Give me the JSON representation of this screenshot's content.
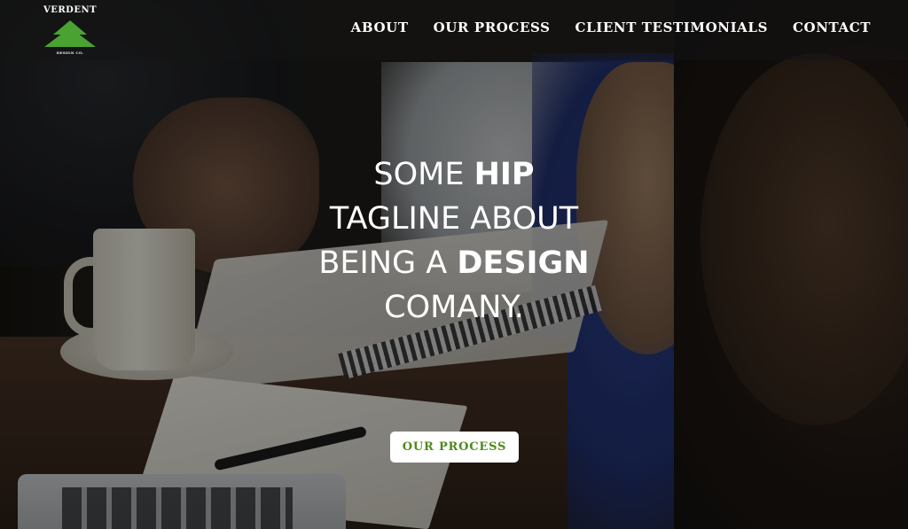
{
  "brand": {
    "name_top": "VERDENT",
    "name_bottom": "DESIGN CO.",
    "logo_icon": "green-pine-tree-icon",
    "accent_color": "#4aa233"
  },
  "nav": {
    "items": [
      {
        "label": "ABOUT"
      },
      {
        "label": "OUR PROCESS"
      },
      {
        "label": "CLIENT TESTIMONIALS"
      },
      {
        "label": "CONTACT"
      }
    ]
  },
  "hero": {
    "tagline": {
      "line1_prefix": "SOME ",
      "line1_bold": "HIP",
      "line2": "TAGLINE ABOUT",
      "line3_prefix": "BEING A ",
      "line3_bold": "DESIGN",
      "line4": "COMANY."
    },
    "cta_label": "OUR PROCESS",
    "cta_text_color": "#4e8a1e"
  }
}
